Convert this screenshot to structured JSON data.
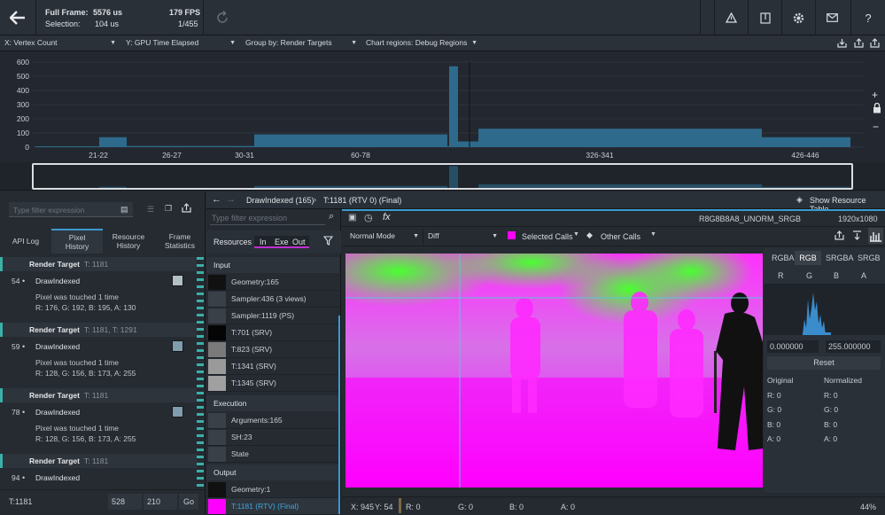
{
  "topbar": {
    "full_frame_label": "Full Frame:",
    "full_frame_value": "5576 us",
    "fps": "179 FPS",
    "selection_label": "Selection:",
    "selection_value": "104 us",
    "selection_count": "1/455",
    "icons": [
      "back-arrow-icon",
      "refresh-icon",
      "warning-triangle-icon",
      "bookmark-icon",
      "gear-icon",
      "mail-icon",
      "help-icon"
    ]
  },
  "filters": {
    "x_axis": "X: Vertex Count",
    "y_axis": "Y: GPU Time Elapsed",
    "group_by": "Group by: Render Targets",
    "chart_regions": "Chart regions: Debug Regions"
  },
  "chart_data": {
    "type": "bar",
    "title": "",
    "xlabel": "",
    "ylabel": "",
    "ylim": [
      0,
      600
    ],
    "yticks": [
      "600",
      "500",
      "400",
      "300",
      "200",
      "100",
      "0"
    ],
    "categories": [
      "21-22",
      "26-27",
      "30-31",
      "60-78",
      "326-341",
      "426-446"
    ],
    "regions": [
      {
        "label": "21-22",
        "value": 5
      },
      {
        "label": "21-22",
        "value": 70
      },
      {
        "label": "26-27",
        "value": 8
      },
      {
        "label": "30-31",
        "value": 55
      },
      {
        "label": "60-78",
        "value": 90
      },
      {
        "label": "60-78",
        "value": 570
      },
      {
        "label": "326-341",
        "value": 40
      },
      {
        "label": "326-341",
        "value": 130
      },
      {
        "label": "426-446",
        "value": 70
      }
    ],
    "color": "#2e6a8c"
  },
  "left": {
    "filter_placeholder": "Type filter expression",
    "tabs": [
      "API Log",
      "Pixel History",
      "Resource History",
      "Frame Statistics"
    ],
    "active_tab": "Pixel History",
    "events": [
      {
        "header": "Render Target",
        "sub": "T: 1181",
        "num": "54",
        "name": "DrawIndexed",
        "line1": "Pixel was touched 1 time",
        "line2": "R: 176, G: 192, B: 195, A: 130",
        "swatch": "#b0c0c3"
      },
      {
        "header": "Render Target",
        "sub": "T: 1181, T: 1291",
        "num": "59",
        "name": "DrawIndexed",
        "line1": "Pixel was touched 1 time",
        "line2": "R: 128, G: 156, B: 173, A: 255",
        "swatch": "#809cad"
      },
      {
        "header": "Render Target",
        "sub": "T: 1181",
        "num": "78",
        "name": "DrawIndexed",
        "line1": "Pixel was touched 1 time",
        "line2": "R: 128, G: 156, B: 173, A: 255",
        "swatch": "#809cad"
      },
      {
        "header": "Render Target",
        "sub": "T: 1181",
        "num": "94",
        "name": "DrawIndexed",
        "line1": "",
        "line2": "",
        "swatch": ""
      }
    ],
    "footer_target": "T:1181",
    "footer_x": "528",
    "footer_y": "210",
    "go_label": "Go"
  },
  "breadcrumb": {
    "call": "DrawIndexed (165)",
    "target": "T:1181 (RTV 0) (Final)",
    "show_resource_table": "Show Resource Table"
  },
  "resources": {
    "filter_placeholder": "Type filter expression",
    "header": "Resources",
    "toggles": [
      "In",
      "Exe",
      "Out"
    ],
    "input_label": "Input",
    "inputs": [
      "Geometry:165",
      "Sampler:436 (3 views)",
      "Sampler:1119 (PS)",
      "T:701 (SRV)",
      "T:823 (SRV)",
      "T:1341 (SRV)",
      "T:1345 (SRV)"
    ],
    "execution_label": "Execution",
    "execution": [
      "Arguments:165",
      "SH:23",
      "State"
    ],
    "output_label": "Output",
    "outputs": [
      "Geometry:1",
      "T:1181 (RTV) (Final)"
    ]
  },
  "viewer": {
    "format": "R8G8B8A8_UNORM_SRGB",
    "resolution": "1920x1080",
    "mode": "Normal Mode",
    "compare": "Diff",
    "selected_calls": "Selected Calls",
    "other_calls": "Other Calls",
    "channel_tabs": [
      "RGBA",
      "RGB",
      "SRGBA",
      "SRGB"
    ],
    "active_channel": "RGB",
    "channels": [
      "R",
      "G",
      "B",
      "A"
    ],
    "range_min": "0.000000",
    "range_max": "255.000000",
    "reset": "Reset",
    "original_label": "Original",
    "normalized_label": "Normalized",
    "original_values": [
      "R: 0",
      "G: 0",
      "B: 0",
      "A: 0"
    ],
    "normalized_values": [
      "R: 0",
      "G: 0",
      "B: 0",
      "A: 0"
    ],
    "status": {
      "x": "X: 945",
      "y": "Y: 54",
      "r": "R: 0",
      "g": "G: 0",
      "b": "B: 0",
      "a": "A: 0",
      "zoom": "44%"
    }
  }
}
